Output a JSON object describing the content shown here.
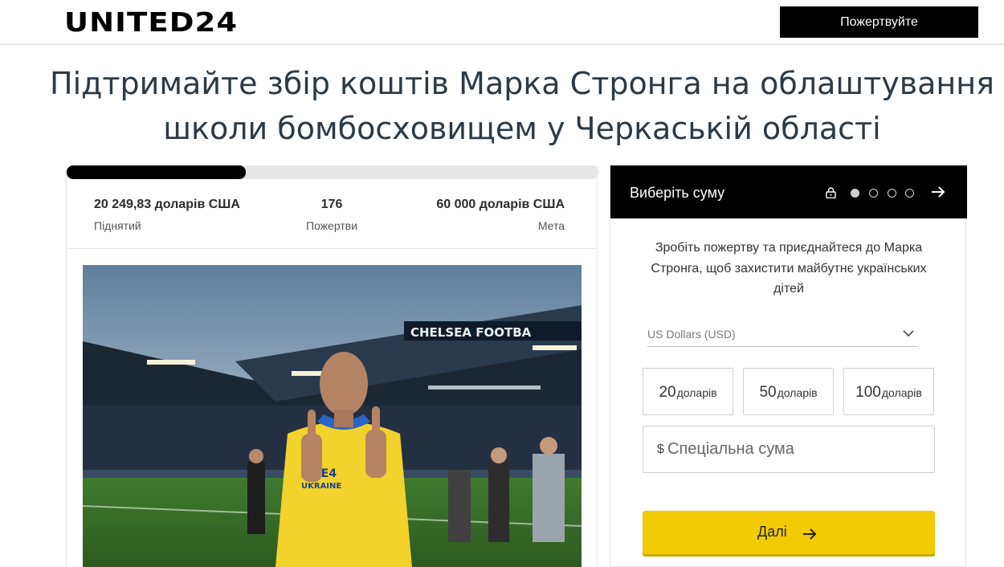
{
  "header": {
    "logo": "UNITED24",
    "donate_label": "Пожертвуйте"
  },
  "page": {
    "title": "Підтримайте збір коштів Марка Стронга на облаштування школи бомбосховищем у Черкаській області"
  },
  "stats": {
    "progress_fraction": 0.3375,
    "raised_value": "20 249,83 доларів США",
    "raised_label": "Піднятий",
    "donations_value": "176",
    "donations_label": "Пожертви",
    "goal_value": "60 000 доларів США",
    "goal_label": "Мета"
  },
  "photo": {
    "stadium_sign": "CHELSEA FOOTBA",
    "shirt_text_1": "AME4",
    "shirt_text_2": "UKRAINE"
  },
  "donation_panel": {
    "title": "Виберіть суму",
    "step_current": 1,
    "step_total": 4,
    "description": "Зробіть пожертву та приєднайтеся до Марка Стронга, щоб захистити майбутнє українських дітей",
    "currency_selected": "US Dollars (USD)",
    "amounts": [
      {
        "value": "20",
        "unit": "доларів"
      },
      {
        "value": "50",
        "unit": "доларів"
      },
      {
        "value": "100",
        "unit": "доларів"
      }
    ],
    "custom_currency_symbol": "$",
    "custom_placeholder": "Спеціальна сума",
    "next_label": "Далі"
  },
  "colors": {
    "accent_yellow": "#f2cb05",
    "header_black": "#000000",
    "title_color": "#2b3a46"
  },
  "icons": [
    "lock-icon",
    "step-dot",
    "arrow-right-icon",
    "chevron-down-icon"
  ]
}
